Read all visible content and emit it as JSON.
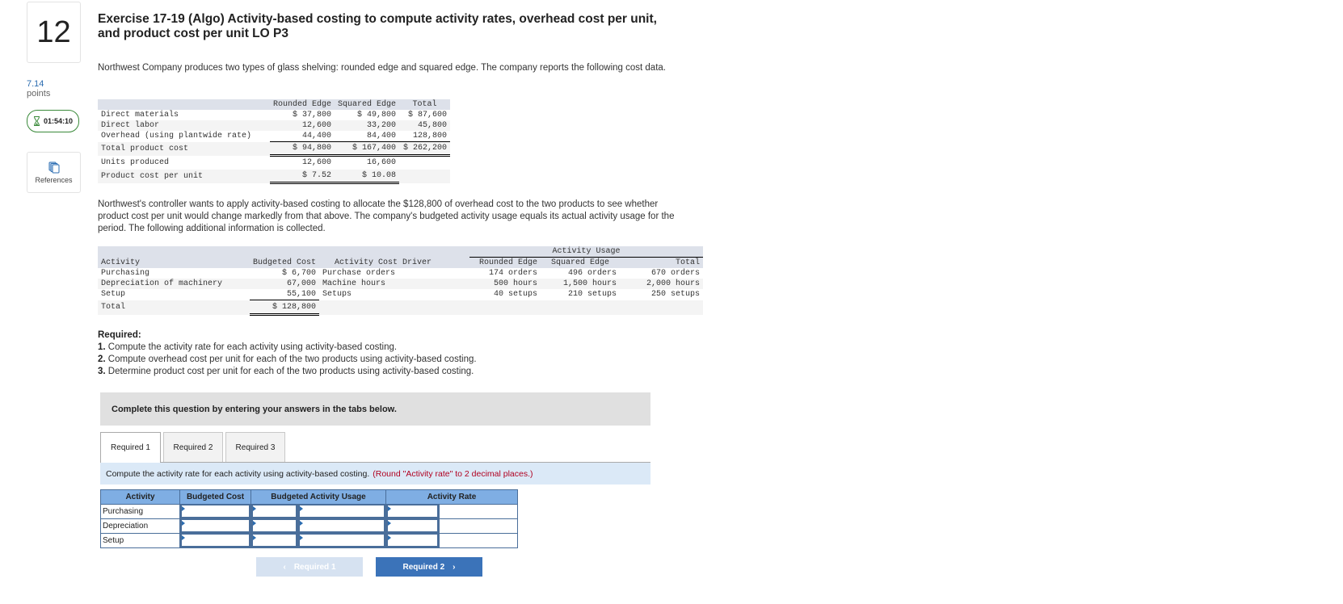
{
  "question": {
    "number": "12",
    "points_value": "7.14",
    "points_label": "points",
    "timer": "01:54:10",
    "references_label": "References",
    "title": "Exercise 17-19 (Algo) Activity-based costing to compute activity rates, overhead cost per unit, and product cost per unit LO P3",
    "intro": "Northwest Company produces two types of glass shelving: rounded edge and squared edge. The company reports the following cost data."
  },
  "cost_table": {
    "headers": [
      "",
      "Rounded Edge",
      "Squared Edge",
      "Total"
    ],
    "rows": [
      {
        "label": "Direct materials",
        "values": [
          "$ 37,800",
          "$ 49,800",
          "$ 87,600"
        ]
      },
      {
        "label": "Direct labor",
        "values": [
          "12,600",
          "33,200",
          "45,800"
        ]
      },
      {
        "label": "Overhead (using plantwide rate)",
        "values": [
          "44,400",
          "84,400",
          "128,800"
        ]
      },
      {
        "label": "Total product cost",
        "values": [
          "$ 94,800",
          "$ 167,400",
          "$ 262,200"
        ]
      },
      {
        "label": "Units produced",
        "values": [
          "12,600",
          "16,600",
          ""
        ]
      },
      {
        "label": "Product cost per unit",
        "values": [
          "$ 7.52",
          "$ 10.08",
          ""
        ]
      }
    ]
  },
  "paragraph2": "Northwest's controller wants to apply activity-based costing to allocate the $128,800 of overhead cost to the two products to see whether product cost per unit would change markedly from that above. The company's budgeted activity usage equals its actual activity usage for the period. The following additional information is collected.",
  "activity_table": {
    "group_header": "Activity Usage",
    "headers": [
      "Activity",
      "Budgeted Cost",
      "Activity Cost Driver",
      "Rounded Edge",
      "Squared Edge",
      "Total"
    ],
    "rows": [
      {
        "activity": "Purchasing",
        "cost": "$ 6,700",
        "driver": "Purchase orders",
        "rounded": "174 orders",
        "squared": "496 orders",
        "total": "670 orders"
      },
      {
        "activity": "Depreciation of machinery",
        "cost": "67,000",
        "driver": "Machine hours",
        "rounded": "500 hours",
        "squared": "1,500 hours",
        "total": "2,000 hours"
      },
      {
        "activity": "Setup",
        "cost": "55,100",
        "driver": "Setups",
        "rounded": "40 setups",
        "squared": "210 setups",
        "total": "250 setups"
      }
    ],
    "total_label": "Total",
    "total_cost": "$ 128,800"
  },
  "required": {
    "heading": "Required:",
    "items": [
      {
        "num": "1.",
        "text": " Compute the activity rate for each activity using activity-based costing."
      },
      {
        "num": "2.",
        "text": " Compute overhead cost per unit for each of the two products using activity-based costing."
      },
      {
        "num": "3.",
        "text": " Determine product cost per unit for each of the two products using activity-based costing."
      }
    ]
  },
  "banner": "Complete this question by entering your answers in the tabs below.",
  "tabs": [
    {
      "label": "Required 1",
      "active": true
    },
    {
      "label": "Required 2",
      "active": false
    },
    {
      "label": "Required 3",
      "active": false
    }
  ],
  "instruction": {
    "text": "Compute the activity rate for each activity using activity-based costing.",
    "note": "(Round \"Activity rate\" to 2 decimal places.)"
  },
  "answer_table": {
    "headers": [
      "Activity",
      "Budgeted Cost",
      "Budgeted Activity Usage",
      "Activity Rate"
    ],
    "rows": [
      {
        "label": "Purchasing",
        "inputs": [
          "",
          "",
          "",
          ""
        ]
      },
      {
        "label": "Depreciation",
        "inputs": [
          "",
          "",
          "",
          ""
        ]
      },
      {
        "label": "Setup",
        "inputs": [
          "",
          "",
          "",
          ""
        ]
      }
    ]
  },
  "nav": {
    "prev_label": "Required 1",
    "next_label": "Required 2"
  }
}
